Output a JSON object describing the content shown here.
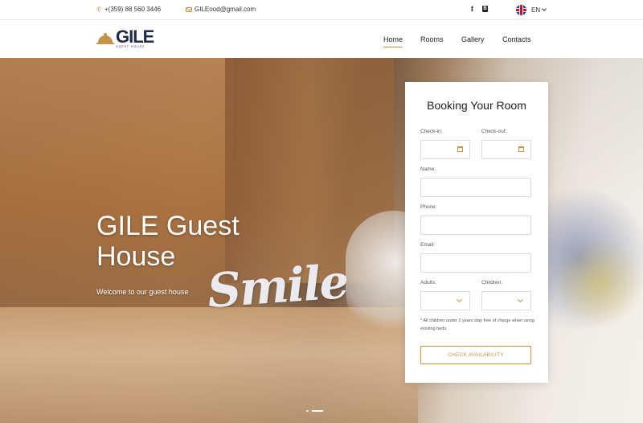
{
  "topbar": {
    "phone": "+(359) 88 560 3446",
    "email": "GILEood@gmail.com",
    "social": [
      "f",
      "B"
    ],
    "language": "EN"
  },
  "header": {
    "logo_name": "GILE",
    "logo_sub": "GUEST HOUSE",
    "nav": [
      "Home",
      "Rooms",
      "Gallery",
      "Contacts"
    ],
    "active_nav": "Home"
  },
  "hero": {
    "title": "GILE Guest House",
    "subtitle": "Welcome to our guest house",
    "slide_count": 2,
    "active_slide": 2
  },
  "booking": {
    "title": "Booking Your Room",
    "checkin_label": "Check-in:",
    "checkout_label": "Check-out:",
    "name_label": "Name:",
    "phone_label": "Phone:",
    "email_label": "Email:",
    "adults_label": "Adults:",
    "children_label": "Children:",
    "note": "* All children under 2 years stay free of charge when using existing beds.",
    "button": "CHECK AVAILABILITY"
  },
  "colors": {
    "accent": "#c9924a",
    "logo": "#1f2a48"
  }
}
